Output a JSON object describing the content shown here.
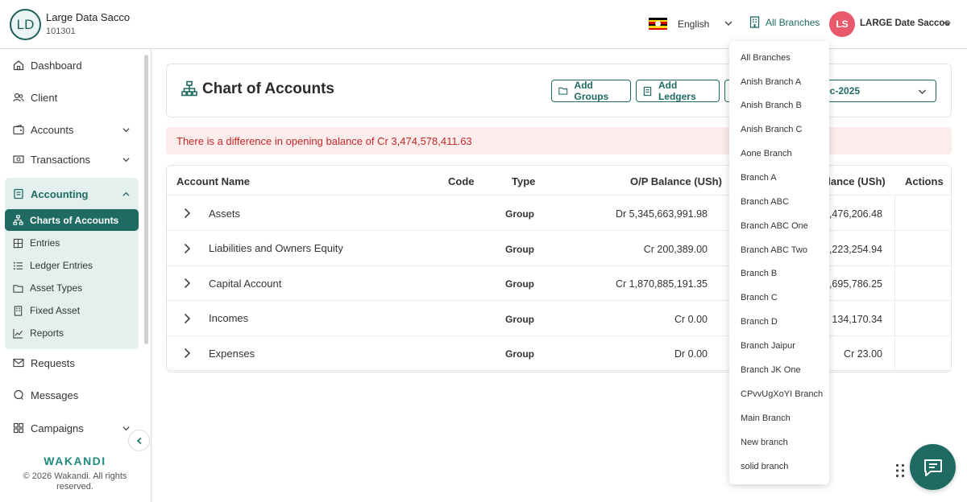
{
  "header": {
    "org_initials": "LD",
    "org_name": "Large Data Sacco",
    "org_code": "101301",
    "language": "English",
    "branch_selector": "All Branches",
    "user_initials": "LS",
    "user_name": "LARGE Date Saccos"
  },
  "sidebar": {
    "items": [
      {
        "label": "Dashboard",
        "icon": "home-icon"
      },
      {
        "label": "Client",
        "icon": "users-icon"
      },
      {
        "label": "Accounts",
        "icon": "wallet-icon"
      },
      {
        "label": "Transactions",
        "icon": "cash-icon"
      }
    ],
    "accounting": {
      "label": "Accounting",
      "icon": "book-icon",
      "children": [
        {
          "label": "Charts of Accounts",
          "icon": "hierarchy-icon",
          "active": true
        },
        {
          "label": "Entries",
          "icon": "table-icon"
        },
        {
          "label": "Ledger Entries",
          "icon": "list-icon"
        },
        {
          "label": "Asset Types",
          "icon": "folder-icon"
        },
        {
          "label": "Fixed Asset",
          "icon": "building-icon"
        },
        {
          "label": "Reports",
          "icon": "chart-line-icon"
        }
      ]
    },
    "bottom_items": [
      {
        "label": "Requests",
        "icon": "mail-icon"
      },
      {
        "label": "Messages",
        "icon": "chat-icon"
      },
      {
        "label": "Campaigns",
        "icon": "grid-icon"
      }
    ],
    "brand": "WAKANDI",
    "copyright": "© 2026 Wakandi. All rights reserved."
  },
  "page": {
    "title": "Chart of Accounts",
    "add_groups": "Add Groups",
    "add_ledgers": "Add Ledgers",
    "period_visible": "ec-2025",
    "alert": "There is a difference in opening balance of Cr 3,474,578,411.63"
  },
  "table": {
    "headers": {
      "name": "Account Name",
      "code": "Code",
      "type": "Type",
      "op_balance": "O/P Balance (USh)",
      "cl_balance": "alance (USh)",
      "actions": "Actions"
    },
    "rows": [
      {
        "name": "Assets",
        "type": "Group",
        "op": "Dr 5,345,663,991.98",
        "cl": "7,476,206.48"
      },
      {
        "name": "Liabilities and Owners Equity",
        "type": "Group",
        "op": "Cr 200,389.00",
        "cl": "7,223,254.94"
      },
      {
        "name": "Capital Account",
        "type": "Group",
        "op": "Cr 1,870,885,191.35",
        "cl": "5,695,786.25"
      },
      {
        "name": "Incomes",
        "type": "Group",
        "op": "Cr 0.00",
        "cl": "r 134,170.34"
      },
      {
        "name": "Expenses",
        "type": "Group",
        "op": "Dr 0.00",
        "cl": "Cr 23.00"
      }
    ]
  },
  "branch_dropdown": [
    "All Branches",
    "Anish Branch A",
    "Anish Branch B",
    "Anish Branch C",
    "Aone Branch",
    "Branch A",
    "Branch ABC",
    "Branch ABC One",
    "Branch ABC Two",
    "Branch B",
    "Branch C",
    "Branch D",
    "Branch Jaipur",
    "Branch JK One",
    "CPvvUgXoYI Branch",
    "Main Branch",
    "New branch",
    "solid branch"
  ],
  "colors": {
    "primary": "#1f6b63",
    "accent_light": "#e3f0ee",
    "alert_bg": "#fdecec",
    "alert_text": "#c62828",
    "user_avatar": "#e8596b"
  }
}
